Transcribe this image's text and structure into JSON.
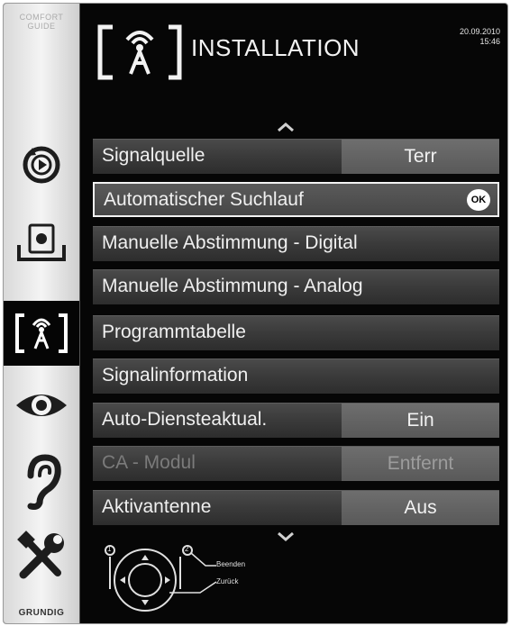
{
  "sidebar": {
    "comfort_guide_line1": "COMFORT",
    "comfort_guide_line2": "GUIDE",
    "brand": "GRUNDIG"
  },
  "header": {
    "title": "INSTALLATION",
    "date": "20.09.2010",
    "time": "15:46"
  },
  "menu": {
    "items": [
      {
        "label": "Signalquelle",
        "value": "Terr"
      },
      {
        "label": "Automatischer Suchlauf",
        "ok": "OK"
      },
      {
        "label": "Manuelle Abstimmung - Digital"
      },
      {
        "label": "Manuelle Abstimmung - Analog"
      },
      {
        "label": "Programmtabelle"
      },
      {
        "label": "Signalinformation"
      },
      {
        "label": "Auto-Diensteaktual.",
        "value": "Ein"
      },
      {
        "label": "CA - Modul",
        "value": "Entfernt"
      },
      {
        "label": "Aktivantenne",
        "value": "Aus"
      }
    ]
  },
  "help": {
    "exit_label": "Beenden",
    "back_label": "Zurück",
    "key1": "1",
    "key2": "2"
  }
}
